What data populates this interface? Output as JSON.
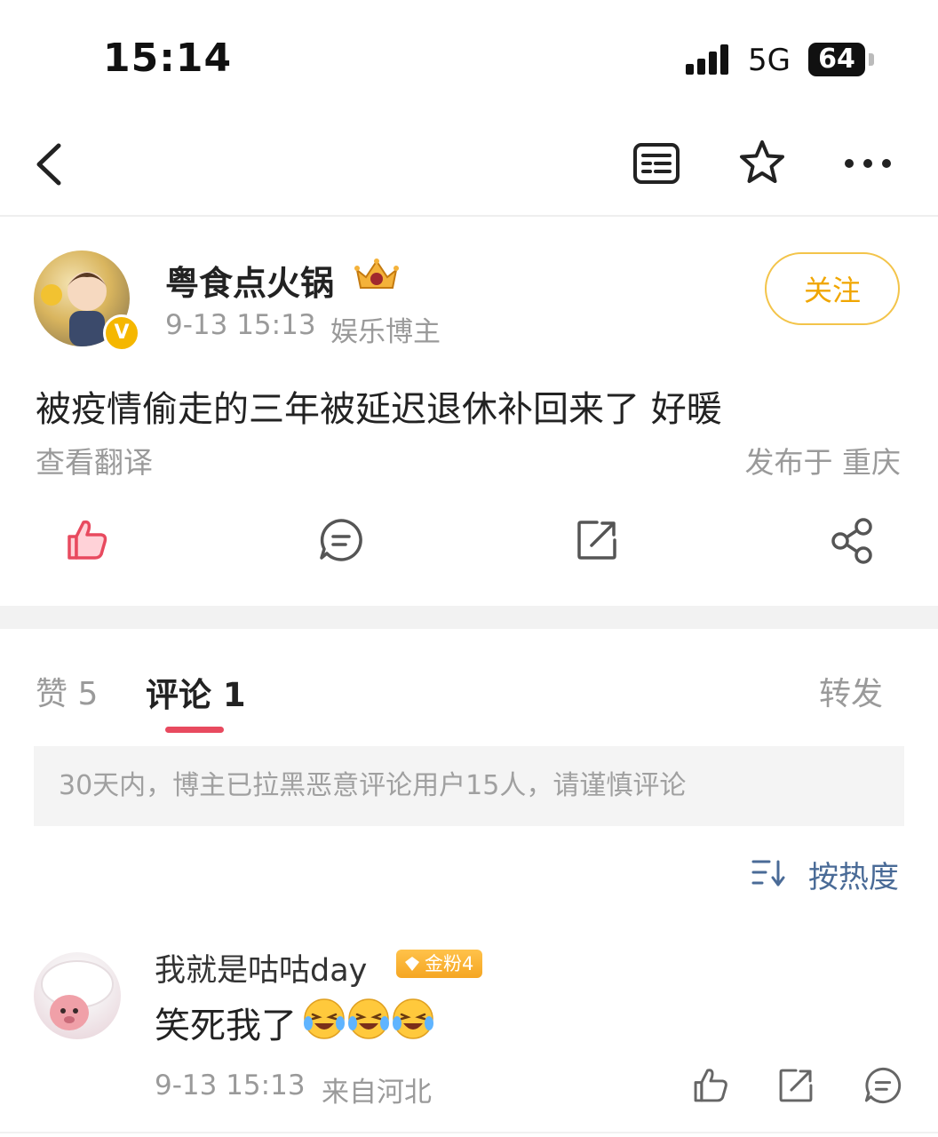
{
  "status_bar": {
    "time": "15:14",
    "network": "5G",
    "battery": "64"
  },
  "nav": {
    "icons": [
      "back-icon",
      "list-icon",
      "star-icon",
      "more-icon"
    ]
  },
  "post": {
    "username": "粤食点火锅",
    "time": "9-13 15:13",
    "user_tag": "娱乐博主",
    "follow_label": "关注",
    "text": "被疫情偷走的三年被延迟退休补回来了 好暖",
    "translate_label": "查看翻译",
    "location": "发布于 重庆",
    "actions": [
      "like-icon",
      "comment-icon",
      "repost-icon",
      "share-icon"
    ],
    "verified_mark": "V"
  },
  "tabs": {
    "likes": "赞 5",
    "comments": "评论 1",
    "reposts": "转发"
  },
  "notice": "30天内，博主已拉黑恶意评论用户15人，请谨慎评论",
  "sort": {
    "label": "按热度"
  },
  "comment": {
    "username": "我就是咕咕day",
    "badge": "金粉4",
    "text": "笑死我了",
    "time": "9-13 15:13",
    "from": "来自河北"
  },
  "colors": {
    "accent_red": "#e84a5f",
    "follow_gold": "#f0a600",
    "link_blue": "#4a6b97",
    "muted_gray": "#9a9a9a"
  }
}
